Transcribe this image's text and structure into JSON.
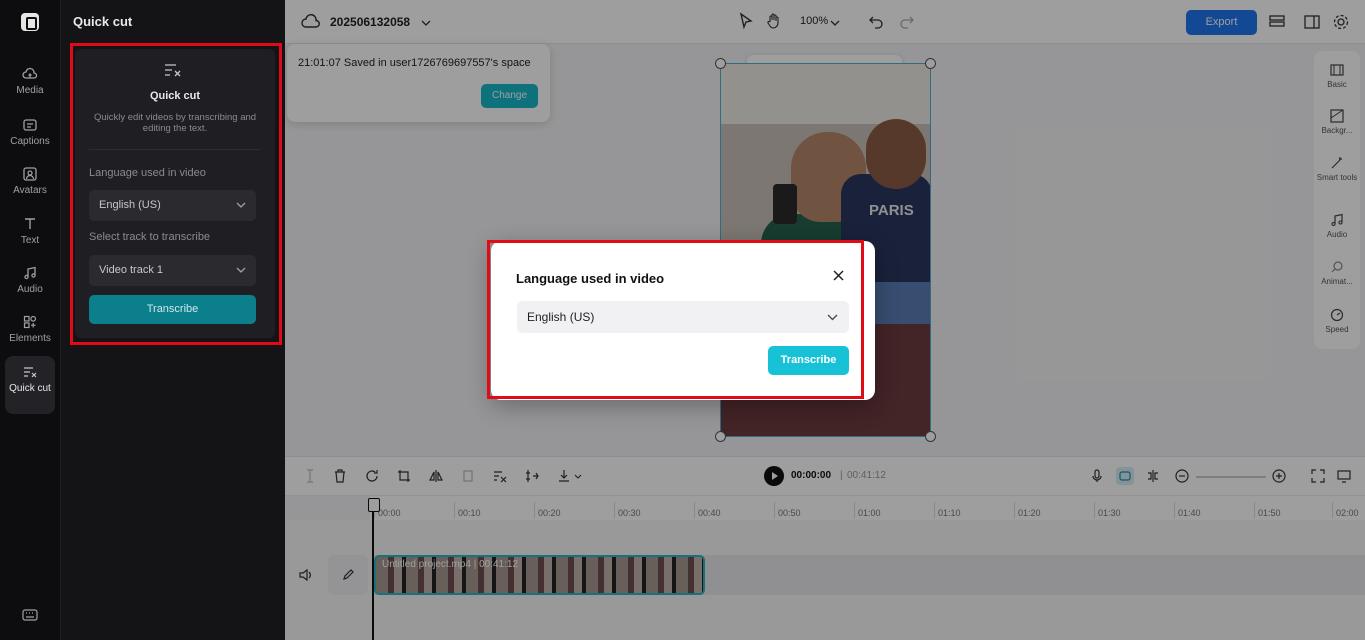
{
  "rail": {
    "items": [
      {
        "label": "Media"
      },
      {
        "label": "Captions"
      },
      {
        "label": "Avatars"
      },
      {
        "label": "Text"
      },
      {
        "label": "Audio"
      },
      {
        "label": "Elements"
      },
      {
        "label": "Quick cut"
      }
    ]
  },
  "panel": {
    "title": "Quick cut",
    "card_title": "Quick cut",
    "description": "Quickly edit videos by transcribing and editing the text.",
    "language_label": "Language used in video",
    "language_value": "English (US)",
    "track_label": "Select track to transcribe",
    "track_value": "Video track 1",
    "transcribe_label": "Transcribe"
  },
  "topbar": {
    "project_name": "202506132058",
    "zoom": "100%",
    "export_label": "Export"
  },
  "saved_popup": {
    "message": "21:01:07 Saved in user1726769697557's space",
    "change_label": "Change"
  },
  "canvas": {
    "shirt_text": "PARIS"
  },
  "right_panel": {
    "items": [
      {
        "label": "Basic"
      },
      {
        "label": "Backgr..."
      },
      {
        "label": "Smart tools"
      },
      {
        "label": "Audio"
      },
      {
        "label": "Animat..."
      },
      {
        "label": "Speed"
      }
    ]
  },
  "playback": {
    "current_time": "00:00:00",
    "separator": "|",
    "total_time": "00:41:12"
  },
  "ruler": {
    "ticks": [
      "00:00",
      "00:10",
      "00:20",
      "00:30",
      "00:40",
      "00:50",
      "01:00",
      "01:10",
      "01:20",
      "01:30",
      "01:40",
      "01:50",
      "02:00"
    ]
  },
  "clip": {
    "title": "Untitled project.mp4 | 00:41:12"
  },
  "modal": {
    "title": "Language used in video",
    "language_value": "English (US)",
    "transcribe_label": "Transcribe"
  },
  "colors": {
    "accent": "#18c2d6",
    "highlight": "#e10b16",
    "export": "#1f74f0"
  }
}
